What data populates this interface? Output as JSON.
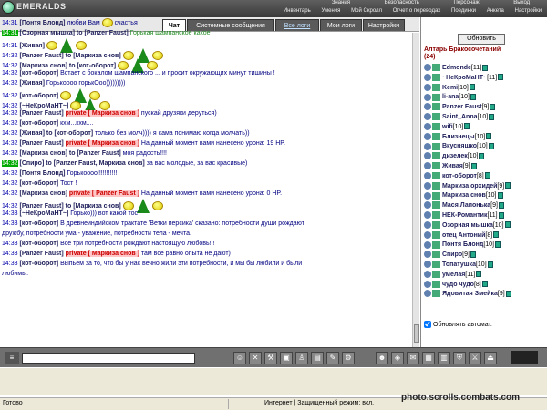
{
  "app": {
    "logo": "EMERALDS"
  },
  "topnav": {
    "row1": [
      "Знания",
      "Безопасность",
      "Персонаж",
      "Выход"
    ],
    "row2": [
      "Инвентарь",
      "Умения",
      "Мой Скролл",
      "Отчет о переводах",
      "Поединки",
      "Анкета",
      "Настройки"
    ]
  },
  "tabs": [
    "Чат",
    "Системные сообщения",
    "Все логи",
    "Мои логи",
    "Настройки"
  ],
  "chat": [
    {
      "time": "14:31",
      "nick": "[Понтя Блонд]",
      "text": "любви Вам",
      "text2": "счастья"
    },
    {
      "time": "14:31",
      "nick": "[Озорная мышка] to [Panzer Faust]",
      "text": "Горькая шампанское какое",
      "green": true,
      "tgreen": true
    },
    {
      "time": "14:31",
      "nick": "[Живая]",
      "text": ""
    },
    {
      "time": "14:32",
      "nick": "[Panzer Faust] to [Маркиза снов]",
      "text": ""
    },
    {
      "time": "14:32",
      "nick": "[Маркиза снов] to [кот-оборот]",
      "text": ""
    },
    {
      "time": "14:32",
      "nick": "[кот-оборот]",
      "text": "Встает с бокалом шампанского ... и просит окружающих минут тишины !"
    },
    {
      "time": "14:32",
      "nick": "[Живая]",
      "text": "Горькоооо горькОоо)))))))))"
    },
    {
      "time": "14:32",
      "nick": "[кот-оборот]",
      "text": ""
    },
    {
      "time": "14:32",
      "nick": "[~НеКроМаНТ~]",
      "text": ""
    },
    {
      "time": "14:32",
      "nick": "[Panzer Faust]",
      "priv": "private [ Маркиза снов ]",
      "text": "пускай друзяки деруться)"
    },
    {
      "time": "14:32",
      "nick": "[кот-оборот]",
      "text": "кхм...кхм...."
    },
    {
      "time": "14:32",
      "nick": "[Живая] to [кот-оборот]",
      "text": "только без молч)))) я сама понимаю когда молчать))"
    },
    {
      "time": "14:32",
      "nick": "[Panzer Faust]",
      "priv": "private [ Маркиза снов ]",
      "text": "На данный момент вами нанесено урона: 19 HP."
    },
    {
      "time": "14:32",
      "nick": "[Маркиза снов] to [Panzer Faust]",
      "text": "моя радость!!!!"
    },
    {
      "time": "14:32",
      "nick": "[Спиро] to [Panzer Faust, Маркиза снов]",
      "text": "за вас молодые, за вас красивые)",
      "tgreen": true
    },
    {
      "time": "14:32",
      "nick": "[Понтя Блонд]",
      "text": "Горькоооо!!!!!!!!!!!"
    },
    {
      "time": "14:32",
      "nick": "[кот-оборот]",
      "text": "Тост !"
    },
    {
      "time": "14:32",
      "nick": "[Маркиза снов]",
      "priv": "private [ Panzer Faust ]",
      "text": "На данный момент вами нанесено урона: 0 HP."
    },
    {
      "time": "14:32",
      "nick": "[Panzer Faust] to [Маркиза снов]",
      "text": ""
    },
    {
      "time": "14:33",
      "nick": "[~НеКроМаНТ~]",
      "text": "Горько))) вот какой тост"
    },
    {
      "time": "14:33",
      "nick": "[кот-оборот]",
      "text": "В древнеиндийском трактате 'Ветки персика' сказано: потребности души рождают"
    },
    {
      "time": "",
      "nick": "",
      "text": "дружбу, потребности ума - уважение, потребности тела - мечта."
    },
    {
      "time": "14:33",
      "nick": "[кот-оборот]",
      "text": "Все три потребности рождают настоящую любовь!!!"
    },
    {
      "time": "14:33",
      "nick": "[Panzer Faust]",
      "priv": "private [ Маркиза снов ]",
      "text": "там всё равно опыта не дают)"
    },
    {
      "time": "14:33",
      "nick": "[кот-оборот]",
      "text": "Выпьем за то, что бы у нас вечно жили эти потребности, и мы бы любили и были"
    },
    {
      "time": "",
      "nick": "",
      "text": "любимы."
    }
  ],
  "sidebar": {
    "refresh": "Обновить",
    "room": "Алтарь Бракосочетаний",
    "count": "(24)",
    "users": [
      {
        "name": "Edmonde",
        "level": "[11]"
      },
      {
        "name": "~НеКроМаНТ~",
        "level": "[11]"
      },
      {
        "name": "Kemi",
        "level": "[10]"
      },
      {
        "name": "li-ana",
        "level": "[10]"
      },
      {
        "name": "Panzer Faust",
        "level": "[9]"
      },
      {
        "name": "Saint_Anna",
        "level": "[10]"
      },
      {
        "name": "wifi",
        "level": "[10]"
      },
      {
        "name": "Близнецы",
        "level": "[10]"
      },
      {
        "name": "Вкусняшко",
        "level": "[10]"
      },
      {
        "name": "дизелек",
        "level": "[10]"
      },
      {
        "name": "Живая",
        "level": "[9]"
      },
      {
        "name": "кот-оборот",
        "level": "[8]"
      },
      {
        "name": "Маркиза орхидей",
        "level": "[9]"
      },
      {
        "name": "Маркиза снов",
        "level": "[10]"
      },
      {
        "name": "Мася Лапонька",
        "level": "[9]"
      },
      {
        "name": "НЕК-Романтик",
        "level": "[11]"
      },
      {
        "name": "Озорная мышка",
        "level": "[10]"
      },
      {
        "name": "отец Антоний",
        "level": "[8]"
      },
      {
        "name": "Понтя Блонд",
        "level": "[10]"
      },
      {
        "name": "Спиро",
        "level": "[9]"
      },
      {
        "name": "Топатушка",
        "level": "[10]"
      },
      {
        "name": "умелая",
        "level": "[11]"
      },
      {
        "name": "чудо чудо",
        "level": "[8]"
      },
      {
        "name": "Ядовитая Змейка",
        "level": "[9]"
      }
    ],
    "auto": "Обновлять автомат."
  },
  "statusbar": {
    "ready": "Готово",
    "zone": "Интернет | Защищенный режим: вкл."
  },
  "watermark": "photo.scrolls.combats.com"
}
